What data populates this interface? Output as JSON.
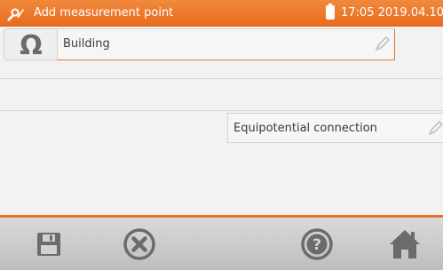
{
  "header": {
    "title": "Add measurement point",
    "clock": "17:05 2019.04.10"
  },
  "fields": {
    "building": "Building",
    "equipotential": "Equipotential connection"
  },
  "colors": {
    "accent": "#e9712a",
    "header_bg": "#ec7b2e",
    "icon_gray": "#6b6b6b"
  },
  "icons": {
    "header": "tools-icon",
    "type": "omega-icon",
    "edit": "pencil-icon",
    "footer": [
      "save-icon",
      "cancel-icon",
      "help-icon",
      "home-icon"
    ]
  }
}
